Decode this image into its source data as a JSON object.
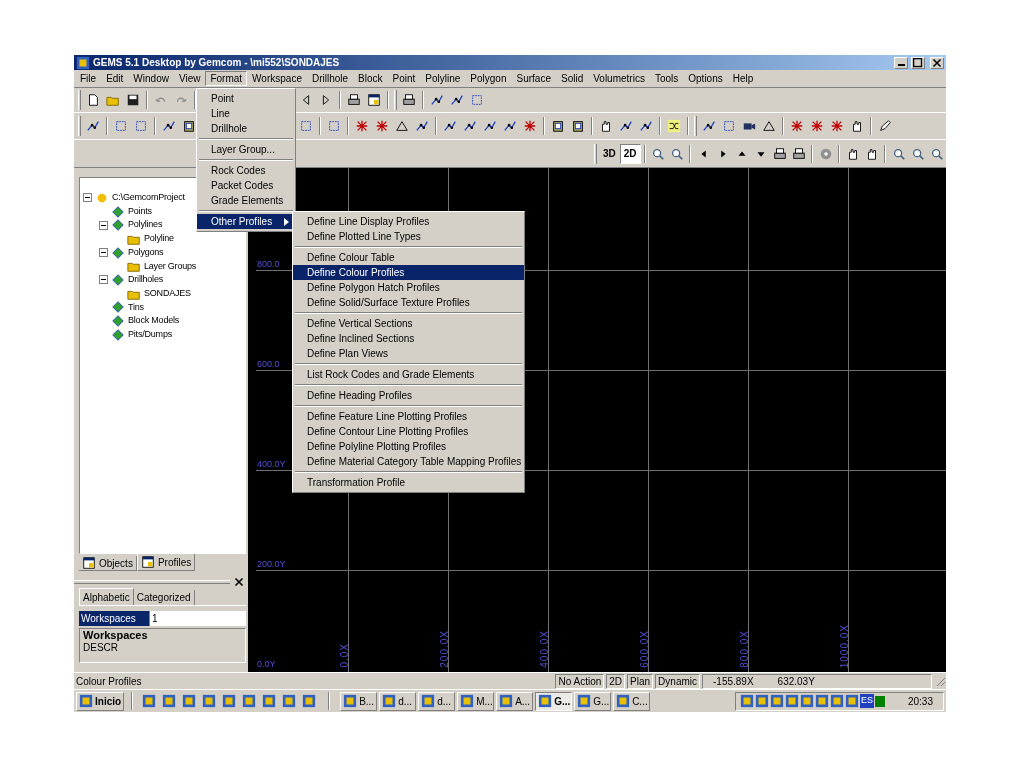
{
  "window": {
    "title": "GEMS 5.1 Desktop by Gemcom - \\mi552\\SONDAJES"
  },
  "menu_bar": [
    {
      "label": "File",
      "selected": false
    },
    {
      "label": "Edit",
      "selected": false
    },
    {
      "label": "Window",
      "selected": false
    },
    {
      "label": "View",
      "selected": false
    },
    {
      "label": "Format",
      "selected": true
    },
    {
      "label": "Workspace",
      "selected": false
    },
    {
      "label": "Drillhole",
      "selected": false
    },
    {
      "label": "Block",
      "selected": false
    },
    {
      "label": "Point",
      "selected": false
    },
    {
      "label": "Polyline",
      "selected": false
    },
    {
      "label": "Polygon",
      "selected": false
    },
    {
      "label": "Surface",
      "selected": false
    },
    {
      "label": "Solid",
      "selected": false
    },
    {
      "label": "Volumetrics",
      "selected": false
    },
    {
      "label": "Tools",
      "selected": false
    },
    {
      "label": "Options",
      "selected": false
    },
    {
      "label": "Help",
      "selected": false
    }
  ],
  "format_menu": {
    "items": [
      {
        "kind": "item",
        "label": "Point",
        "selected": false
      },
      {
        "kind": "item",
        "label": "Line",
        "selected": false
      },
      {
        "kind": "item",
        "label": "Drillhole",
        "selected": false
      },
      {
        "kind": "separator"
      },
      {
        "kind": "item",
        "label": "Layer Group...",
        "selected": false
      },
      {
        "kind": "separator"
      },
      {
        "kind": "item",
        "label": "Rock Codes",
        "selected": false
      },
      {
        "kind": "item",
        "label": "Packet Codes",
        "selected": false
      },
      {
        "kind": "item",
        "label": "Grade Elements",
        "selected": false
      },
      {
        "kind": "separator"
      },
      {
        "kind": "submenu",
        "label": "Other Profiles",
        "selected": true
      }
    ]
  },
  "other_profiles_menu": {
    "items": [
      {
        "kind": "item",
        "label": "Define Line Display Profiles",
        "selected": false
      },
      {
        "kind": "item",
        "label": "Define Plotted Line Types",
        "selected": false
      },
      {
        "kind": "separator"
      },
      {
        "kind": "item",
        "label": "Define Colour Table",
        "selected": false
      },
      {
        "kind": "item",
        "label": "Define Colour Profiles",
        "selected": true
      },
      {
        "kind": "item",
        "label": "Define Polygon Hatch Profiles",
        "selected": false
      },
      {
        "kind": "item",
        "label": "Define Solid/Surface Texture Profiles",
        "selected": false
      },
      {
        "kind": "separator"
      },
      {
        "kind": "item",
        "label": "Define Vertical Sections",
        "selected": false
      },
      {
        "kind": "item",
        "label": "Define Inclined Sections",
        "selected": false
      },
      {
        "kind": "item",
        "label": "Define Plan Views",
        "selected": false
      },
      {
        "kind": "separator"
      },
      {
        "kind": "item",
        "label": "List Rock Codes and Grade Elements",
        "selected": false
      },
      {
        "kind": "separator"
      },
      {
        "kind": "item",
        "label": "Define Heading Profiles",
        "selected": false
      },
      {
        "kind": "separator"
      },
      {
        "kind": "item",
        "label": "Define Feature Line Plotting Profiles",
        "selected": false
      },
      {
        "kind": "item",
        "label": "Define Contour Line Plotting Profiles",
        "selected": false
      },
      {
        "kind": "item",
        "label": "Define Polyline Plotting Profiles",
        "selected": false
      },
      {
        "kind": "item",
        "label": "Define Material Category Table Mapping Profiles",
        "selected": false
      },
      {
        "kind": "separator"
      },
      {
        "kind": "item",
        "label": "Transformation Profile",
        "selected": false
      }
    ]
  },
  "view_buttons": [
    {
      "label": "3D",
      "selected": false
    },
    {
      "label": "2D",
      "selected": true
    }
  ],
  "tree": [
    {
      "label": "C:\\GemcomProject",
      "expanded": true,
      "children": [
        {
          "label": "Points"
        },
        {
          "label": "Polylines",
          "expanded": true,
          "children": [
            {
              "label": "Polyline"
            }
          ]
        },
        {
          "label": "Polygons",
          "expanded": true,
          "children": [
            {
              "label": "Layer Groups"
            }
          ]
        },
        {
          "label": "Drillholes",
          "expanded": true,
          "children": [
            {
              "label": "SONDAJES"
            }
          ]
        },
        {
          "label": "Tins"
        },
        {
          "label": "Block Models"
        },
        {
          "label": "Pits/Dumps"
        }
      ]
    }
  ],
  "panel_tabs": [
    {
      "label": "Objects",
      "selected": false
    },
    {
      "label": "Profiles",
      "selected": true
    }
  ],
  "property_tabs": [
    {
      "label": "Alphabetic",
      "selected": true
    },
    {
      "label": "Categorized",
      "selected": false
    }
  ],
  "property_grid": {
    "rows": [
      {
        "name": "Workspaces",
        "value": "1",
        "selected": true
      }
    ]
  },
  "description": {
    "title": "Workspaces",
    "text": "DESCR"
  },
  "canvas": {
    "y_labels": [
      "800.0",
      "600.0",
      "400.0Y",
      "200.0Y",
      "0.0Y"
    ],
    "x_labels": [
      "0.0X",
      "200.0X",
      "400.0X",
      "600.0X",
      "800.0X",
      "1000.0X"
    ]
  },
  "status_bar": {
    "message": "Colour Profiles",
    "panels": [
      "No Action",
      "2D",
      "Plan",
      "Dynamic"
    ],
    "x": "-155.89X",
    "y": "632.03Y"
  },
  "taskbar": {
    "start": "Inicio",
    "tasks": [
      {
        "label": "B...",
        "selected": false
      },
      {
        "label": "d...",
        "selected": false
      },
      {
        "label": "d...",
        "selected": false
      },
      {
        "label": "M...",
        "selected": false
      },
      {
        "label": "A...",
        "selected": false
      },
      {
        "label": "G...",
        "selected": true
      },
      {
        "label": "G...",
        "selected": false
      },
      {
        "label": "C...",
        "selected": false
      }
    ],
    "language": "ES",
    "clock": "20:33"
  }
}
